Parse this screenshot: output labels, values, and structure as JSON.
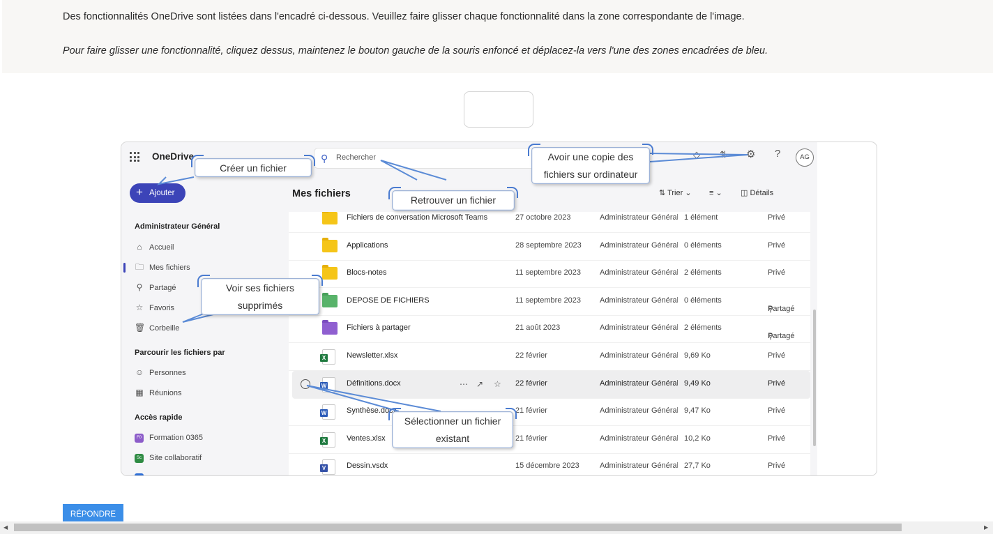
{
  "instructions": {
    "line1": "Des fonctionnalités OneDrive sont listées dans l'encadré ci-dessous. Veuillez faire glisser chaque fonctionnalité dans la zone correspondante de l'image.",
    "line2": "Pour faire glisser une fonctionnalité, cliquez dessus, maintenez le bouton gauche de la souris enfoncé et déplacez-la vers l'une des zones encadrées de bleu."
  },
  "onedrive": {
    "brand": "OneDrive",
    "search_placeholder": "Rechercher",
    "add_label": "Ajouter",
    "avatar": "AG",
    "main_title": "Mes fichiers",
    "toolbar": {
      "sort": "Trier",
      "details": "Détails"
    },
    "sidebar": {
      "user_header": "Administrateur Général",
      "items": [
        {
          "label": "Accueil",
          "icon": "home-icon"
        },
        {
          "label": "Mes fichiers",
          "icon": "folder-icon"
        },
        {
          "label": "Partagé",
          "icon": "people-icon"
        },
        {
          "label": "Favoris",
          "icon": "star-icon"
        },
        {
          "label": "Corbeille",
          "icon": "trash-icon"
        }
      ],
      "browse_header": "Parcourir les fichiers par",
      "browse_items": [
        {
          "label": "Personnes",
          "icon": "person-icon"
        },
        {
          "label": "Réunions",
          "icon": "calendar-icon"
        }
      ],
      "quick_header": "Accès rapide",
      "quick_items": [
        {
          "label": "Formation 0365",
          "badge": "F0",
          "color": "#8c5cc9"
        },
        {
          "label": "Site collaboratif",
          "badge": "Sc",
          "color": "#2e8b43"
        }
      ]
    },
    "files": [
      {
        "name": "Fichiers de conversation Microsoft Teams",
        "date": "27 octobre 2023",
        "owner": "Administrateur Général",
        "size": "1 élément",
        "share": "Privé",
        "type": "folder"
      },
      {
        "name": "Applications",
        "date": "28 septembre 2023",
        "owner": "Administrateur Général",
        "size": "0 éléments",
        "share": "Privé",
        "type": "folder"
      },
      {
        "name": "Blocs-notes",
        "date": "11 septembre 2023",
        "owner": "Administrateur Général",
        "size": "2 éléments",
        "share": "Privé",
        "type": "folder"
      },
      {
        "name": "DEPOSE DE FICHIERS",
        "date": "11 septembre 2023",
        "owner": "Administrateur Général",
        "size": "0 éléments",
        "share": "Partagé",
        "type": "shared-folder"
      },
      {
        "name": "Fichiers à partager",
        "date": "21 août 2023",
        "owner": "Administrateur Général",
        "size": "2 éléments",
        "share": "Partagé",
        "type": "purple-folder"
      },
      {
        "name": "Newsletter.xlsx",
        "date": "22 février",
        "owner": "Administrateur Général",
        "size": "9,69 Ko",
        "share": "Privé",
        "type": "excel"
      },
      {
        "name": "Définitions.docx",
        "date": "22 février",
        "owner": "Administrateur Général",
        "size": "9,49 Ko",
        "share": "Privé",
        "type": "word"
      },
      {
        "name": "Synthèse.docx",
        "date": "21 février",
        "owner": "Administrateur Général",
        "size": "9,47 Ko",
        "share": "Privé",
        "type": "word"
      },
      {
        "name": "Ventes.xlsx",
        "date": "21 février",
        "owner": "Administrateur Général",
        "size": "10,2 Ko",
        "share": "Privé",
        "type": "excel"
      },
      {
        "name": "Dessin.vsdx",
        "date": "15 décembre 2023",
        "owner": "Administrateur Général",
        "size": "27,7 Ko",
        "share": "Privé",
        "type": "visio"
      }
    ]
  },
  "callouts": {
    "create": "Créer un fichier",
    "find": "Retrouver un fichier",
    "sync_line1": "Avoir une copie des",
    "sync_line2": "fichiers sur ordinateur",
    "trash_line1": "Voir ses fichiers",
    "trash_line2": "supprimés",
    "select_line1": "Sélectionner un fichier",
    "select_line2": "existant"
  },
  "submit_label": "RÉPONDRE"
}
